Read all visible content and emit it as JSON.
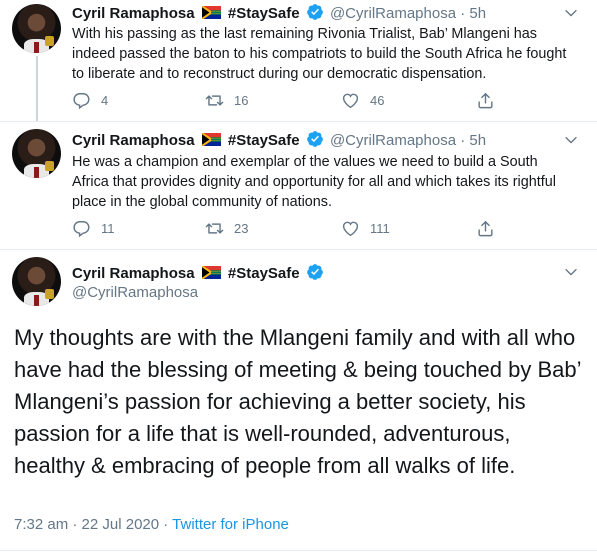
{
  "author": {
    "name": "Cyril Ramaphosa",
    "hashtag": "#StaySafe",
    "handle": "@CyrilRamaphosa"
  },
  "icons": {
    "flag": "south-africa-flag-icon",
    "verified": "verified-badge-icon",
    "caret": "chevron-down-icon",
    "reply": "reply-icon",
    "retweet": "retweet-icon",
    "like": "heart-icon",
    "share": "share-icon"
  },
  "colors": {
    "accent": "#1da1f2",
    "secondary_text": "#657786",
    "source_link": "#1b95e0"
  },
  "tweets": [
    {
      "separator": " · ",
      "time": "5h",
      "text": "With his passing as the last remaining Rivonia Trialist, Bab’ Mlangeni has indeed passed the baton to his compatriots to build the South Africa he fought to liberate and to reconstruct during our democratic dispensation.",
      "replies": "4",
      "retweets": "16",
      "likes": "46"
    },
    {
      "separator": " · ",
      "time": "5h",
      "text": "He was a champion and exemplar of the values we need to build a South Africa that provides dignity and opportunity for all and which takes its rightful place in the global community of nations.",
      "replies": "11",
      "retweets": "23",
      "likes": "111"
    }
  ],
  "main_tweet": {
    "text": "My thoughts are with the Mlangeni family and with all who have had the blessing of meeting & being touched by Bab’ Mlangeni’s passion for achieving a better society, his passion for a life that is well-rounded, adventurous, healthy & embracing of people from all walks of life.",
    "timestamp": "7:32 am · 22 Jul 2020",
    "meta_separator": " · ",
    "source": "Twitter for iPhone"
  }
}
